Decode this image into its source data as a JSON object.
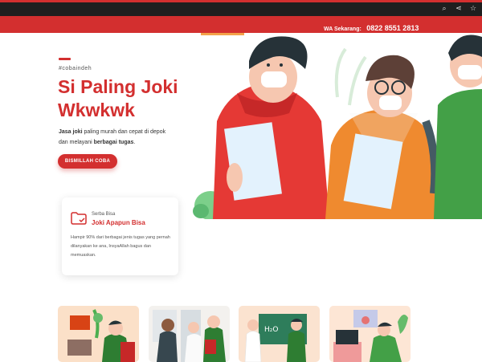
{
  "browser": {
    "icons": [
      "search-icon",
      "share-icon",
      "star-icon"
    ]
  },
  "topbar": {
    "wa_label": "WA Sekarang:",
    "phone": "0822 8551 2813"
  },
  "hero": {
    "tag": "#cobaindeh",
    "title": "Si Paling Joki Wkwkwk",
    "desc_bold1": "Jasa joki",
    "desc_1": " paling murah dan cepat di depok",
    "desc_2": "dan melayani ",
    "desc_bold2": "berbagai tugas",
    "desc_end": ".",
    "button": "BISMILLAH COBA"
  },
  "feature_card": {
    "subtitle": "Serba Bisa",
    "title": "Joki Apapun Bisa",
    "body": "Hampir 90% dari berbagai jenis tugas yang pernah dilanyakan ke ana, InsyaAllah bagus dan memuaskan."
  },
  "colors": {
    "primary": "#d32f2f",
    "accent": "#f4a24a",
    "text": "#333333"
  }
}
